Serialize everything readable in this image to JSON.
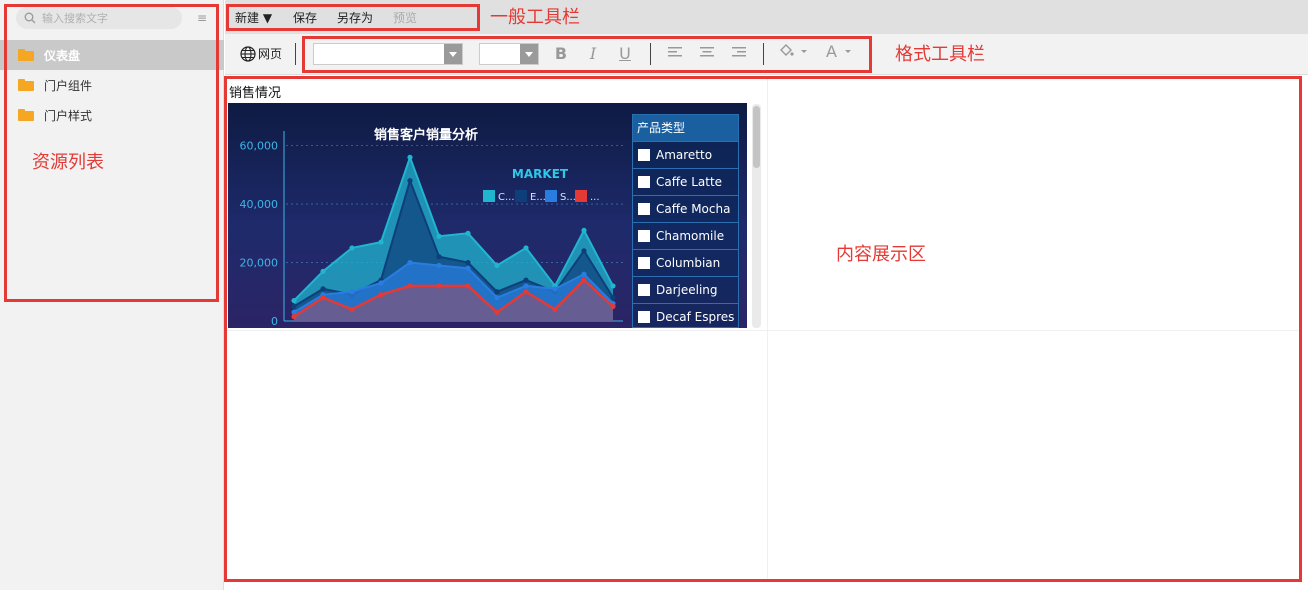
{
  "sidebar": {
    "search_placeholder": "输入搜索文字",
    "items": [
      {
        "label": "仪表盘",
        "active": true
      },
      {
        "label": "门户组件",
        "active": false
      },
      {
        "label": "门户样式",
        "active": false
      }
    ]
  },
  "toolbar": {
    "new_label": "新建 ▼",
    "save_label": "保存",
    "save_as_label": "另存为",
    "preview_label": "预览"
  },
  "format_toolbar": {
    "web_label": "网页"
  },
  "annotations": {
    "general_toolbar": "一般工具栏",
    "format_toolbar": "格式工具栏",
    "resource_list": "资源列表",
    "content_area": "内容展示区"
  },
  "content": {
    "widget_title": "销售情况"
  },
  "chart_data": {
    "type": "area",
    "title": "销售客户销量分析",
    "legend_title": "MARKET",
    "legend_entries": [
      "C...",
      "E...",
      "S...",
      "..."
    ],
    "y_ticks": [
      "60,000",
      "40,000",
      "20,000",
      "0"
    ],
    "ylim": [
      0,
      65000
    ],
    "series": [
      {
        "color": "#20b6d0",
        "values": [
          7000,
          17000,
          25000,
          27000,
          56000,
          29000,
          30000,
          19000,
          25000,
          12000,
          31000,
          12000
        ]
      },
      {
        "color": "#0e3f7a",
        "values": [
          5000,
          11000,
          9000,
          14000,
          48000,
          22000,
          20000,
          10000,
          14000,
          10000,
          24000,
          8000
        ]
      },
      {
        "color": "#2a7de0",
        "values": [
          3000,
          9000,
          10000,
          13000,
          20000,
          19000,
          18000,
          8000,
          12000,
          11000,
          16000,
          6000
        ]
      },
      {
        "color": "#e53935",
        "values": [
          1500,
          8000,
          4000,
          9000,
          12000,
          12000,
          12000,
          3000,
          10000,
          4000,
          14000,
          5000
        ]
      }
    ]
  },
  "product_panel": {
    "header": "产品类型",
    "items": [
      "Amaretto",
      "Caffe Latte",
      "Caffe Mocha",
      "Chamomile",
      "Columbian",
      "Darjeeling",
      "Decaf Espres"
    ]
  }
}
